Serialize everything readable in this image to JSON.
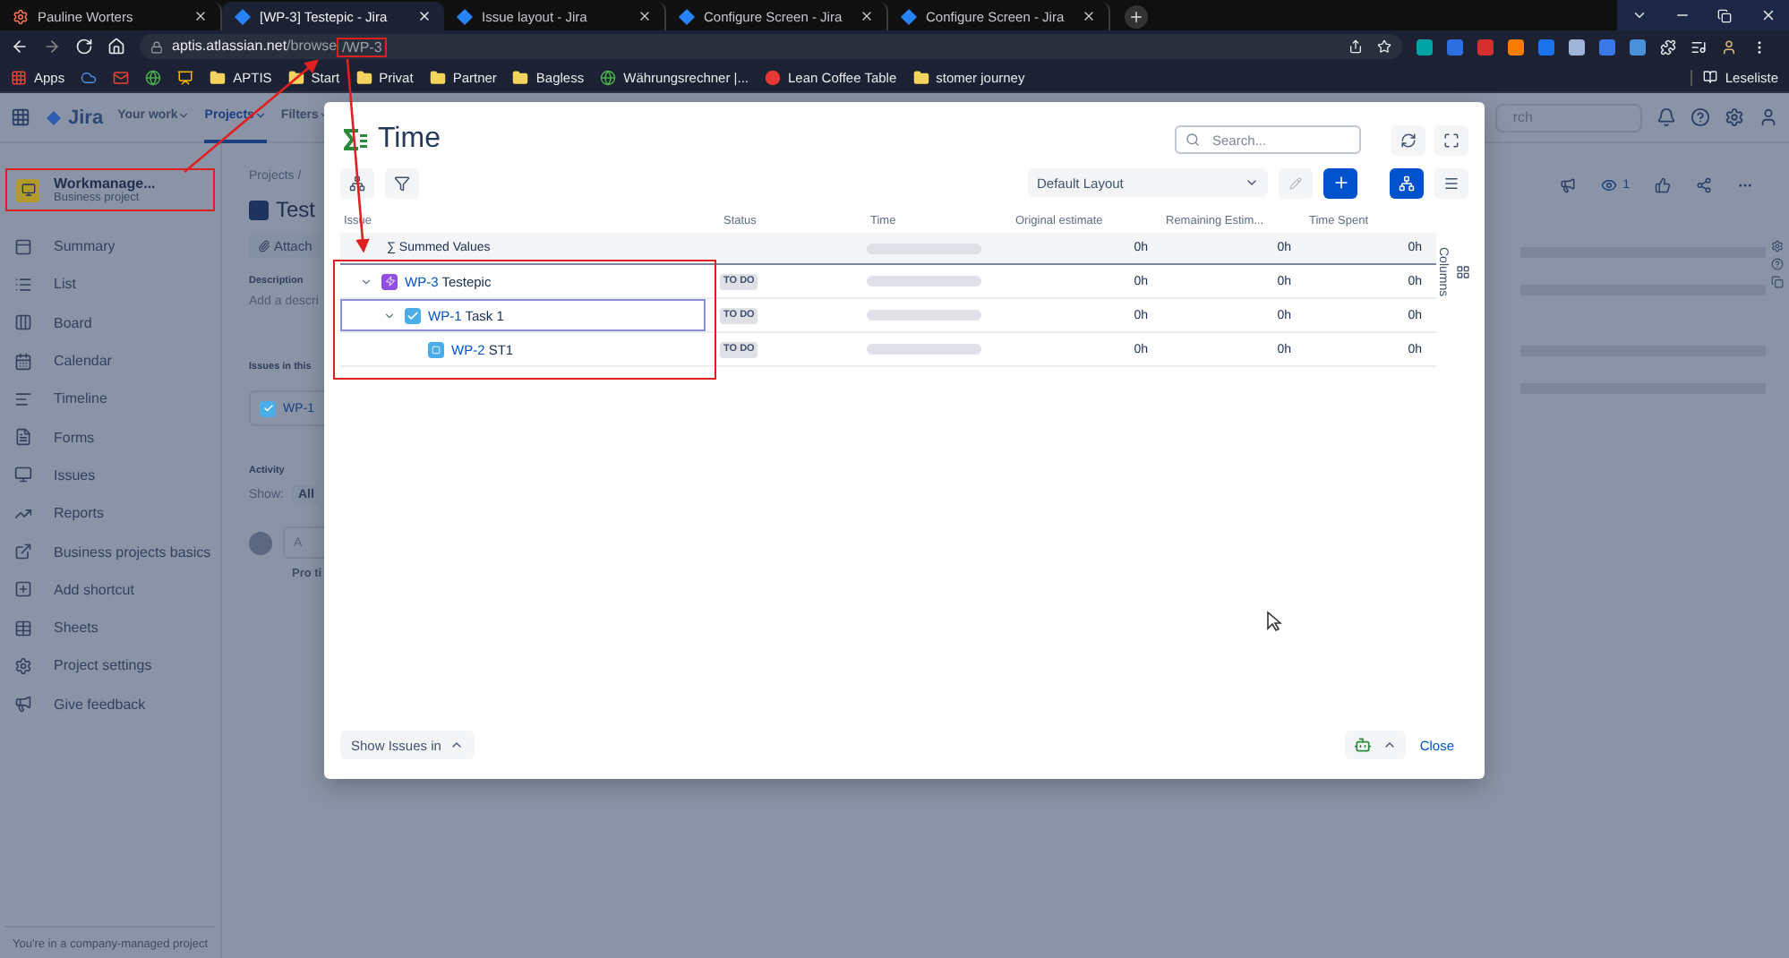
{
  "browser": {
    "tabs": [
      {
        "title": "Pauline Worters",
        "selected": false,
        "kind": "hub"
      },
      {
        "title": "[WP-3] Testepic - Jira",
        "selected": true,
        "kind": "jira"
      },
      {
        "title": "Issue layout - Jira",
        "selected": false,
        "kind": "jira"
      },
      {
        "title": "Configure Screen - Jira",
        "selected": false,
        "kind": "jira"
      },
      {
        "title": "Configure Screen - Jira",
        "selected": false,
        "kind": "jira"
      }
    ],
    "url": {
      "host": "aptis.atlassian.net",
      "path": "/browse",
      "highlight": "/WP-3"
    },
    "bookmarks": [
      {
        "kind": "apps",
        "label": "Apps"
      },
      {
        "kind": "cloud"
      },
      {
        "kind": "mail"
      },
      {
        "kind": "site"
      },
      {
        "kind": "slides"
      },
      {
        "kind": "folder",
        "label": "APTIS"
      },
      {
        "kind": "folder",
        "label": "Start"
      },
      {
        "kind": "folder",
        "label": "Privat"
      },
      {
        "kind": "folder",
        "label": "Partner"
      },
      {
        "kind": "folder",
        "label": "Bagless"
      },
      {
        "kind": "site",
        "label": "Währungsrechner |..."
      },
      {
        "kind": "record",
        "label": "Lean Coffee Table"
      },
      {
        "kind": "folder",
        "label": "stomer journey"
      }
    ],
    "reading_list": "Leseliste"
  },
  "jira": {
    "logo": "Jira",
    "nav": [
      {
        "label": "Your work",
        "selected": false
      },
      {
        "label": "Projects",
        "selected": true
      },
      {
        "label": "Filters",
        "selected": false
      }
    ],
    "search_visible": "rch",
    "sidebar": {
      "project": {
        "name": "Workmanage...",
        "type": "Business project"
      },
      "items": [
        {
          "label": "Summary",
          "kind": "summary"
        },
        {
          "label": "List",
          "kind": "list"
        },
        {
          "label": "Board",
          "kind": "board"
        },
        {
          "label": "Calendar",
          "kind": "calendar"
        },
        {
          "label": "Timeline",
          "kind": "timeline"
        },
        {
          "label": "Forms",
          "kind": "forms"
        },
        {
          "label": "Issues",
          "kind": "issues"
        },
        {
          "label": "Reports",
          "kind": "reports"
        },
        {
          "label": "Business projects basics",
          "kind": "link"
        },
        {
          "label": "Add shortcut",
          "kind": "shortcut"
        },
        {
          "label": "Sheets",
          "kind": "sheets"
        },
        {
          "label": "Project settings",
          "kind": "settings"
        },
        {
          "label": "Give feedback",
          "kind": "feedback"
        }
      ],
      "footer": "You're in a company-managed project"
    },
    "issue": {
      "breadcrumb": "Projects",
      "separator": "/",
      "title": "Test",
      "attach": "Attach",
      "description_label": "Description",
      "description_placeholder": "Add a descri",
      "child_label": "Issues in this",
      "child_issue": "WP-1",
      "activity": "Activity",
      "show_label": "Show:",
      "show_value": "All",
      "comment_placeholder": "A",
      "tip": "Pro ti",
      "watchers": "1"
    }
  },
  "modal": {
    "title": "Time",
    "search_placeholder": "Search...",
    "layout": "Default Layout",
    "edit_disabled": true,
    "views": [
      {
        "kind": "tree",
        "selected": true
      },
      {
        "kind": "list",
        "selected": false
      }
    ],
    "columns": [
      "Issue",
      "Status",
      "Time",
      "Original estimate",
      "Remaining Estim...",
      "Time Spent"
    ],
    "columns_toggle": "Columns",
    "summary": {
      "label": "∑ Summed Values",
      "level": 0,
      "original": "0h",
      "remaining": "0h",
      "spent": "0h"
    },
    "rows": [
      {
        "key": "WP-3",
        "summary": "Testepic",
        "kind": "epic",
        "expanded": true,
        "selected": false,
        "status": "TO DO",
        "level": 0,
        "original": "0h",
        "remaining": "0h",
        "spent": "0h",
        "children": [
          {
            "key": "WP-1",
            "summary": "Task 1",
            "kind": "task",
            "expanded": true,
            "selected": true,
            "status": "TO DO",
            "level": 0,
            "original": "0h",
            "remaining": "0h",
            "spent": "0h",
            "children": [
              {
                "key": "WP-2",
                "summary": "ST1",
                "kind": "subtask",
                "selected": false,
                "status": "TO DO",
                "level": 0,
                "original": "0h",
                "remaining": "0h",
                "spent": "0h"
              }
            ]
          }
        ]
      }
    ],
    "show_issues": "Show Issues in",
    "close": "Close"
  }
}
